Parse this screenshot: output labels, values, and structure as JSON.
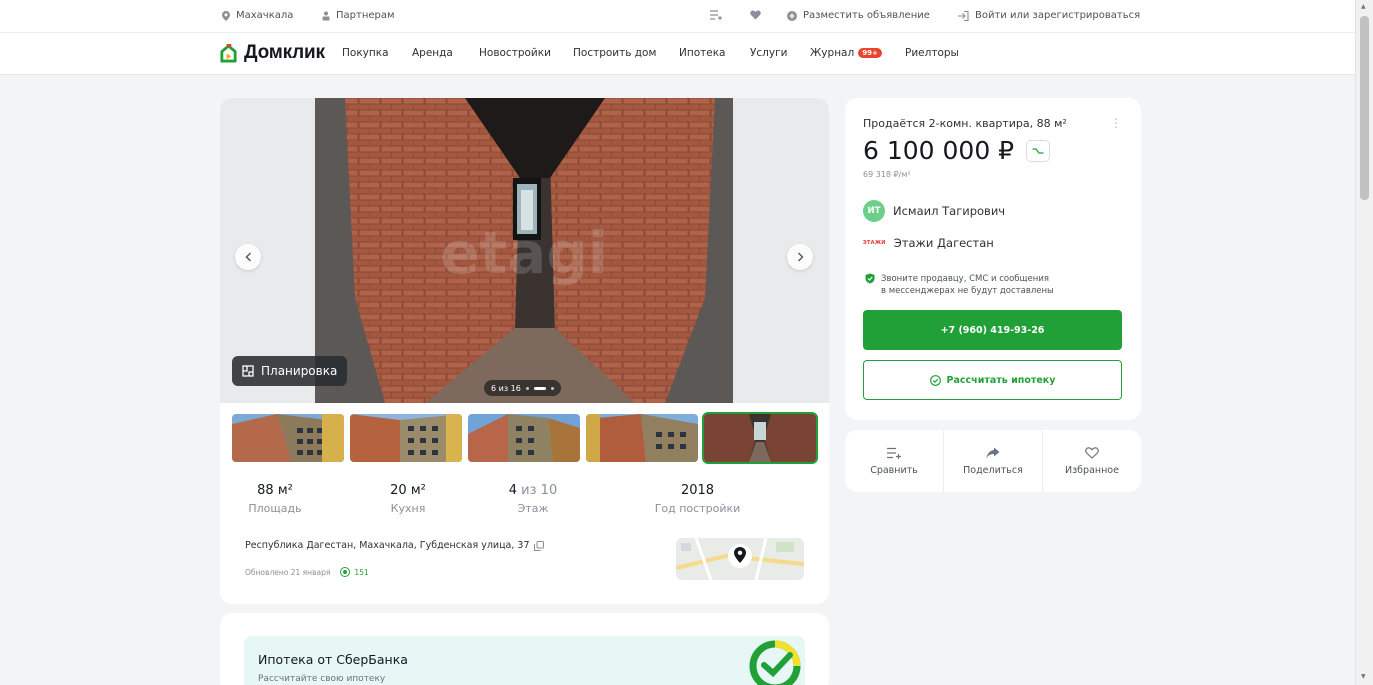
{
  "topbar": {
    "city": "Махачкала",
    "partners": "Партнерам",
    "post_ad": "Разместить объявление",
    "login": "Войти или зарегистрироваться"
  },
  "nav": {
    "logo": "Домклик",
    "items": [
      "Покупка",
      "Аренда",
      "Новостройки",
      "Построить дом",
      "Ипотека",
      "Услуги",
      "Журнал",
      "Риелторы"
    ],
    "journal_badge": "99+"
  },
  "gallery": {
    "watermark": "etagi",
    "plan_label": "Планировка",
    "counter": "6 из 16"
  },
  "params": [
    {
      "value": "88 м²",
      "label": "Площадь"
    },
    {
      "value": "20 м²",
      "label": "Кухня"
    },
    {
      "value_main": "4",
      "value_rest": " из 10",
      "label": "Этаж"
    },
    {
      "value": "2018",
      "label": "Год постройки"
    }
  ],
  "address": "Республика Дагестан, Махачкала, Губденская улица, 37",
  "updated": "Обновлено 21 января",
  "views": "151",
  "mortgage_banner": {
    "title": "Ипотека от СберБанка",
    "subtitle": "Рассчитайте свою ипотеку"
  },
  "offer": {
    "title": "Продаётся 2-комн. квартира, 88 м²",
    "price": "6 100 000 ₽",
    "price_per_sqm": "69 318 ₽/м²",
    "seller_initials": "ИТ",
    "seller_name": "Исмаил Тагирович",
    "agency_logo": "ЭТАЖИ",
    "agency": "Этажи Дагестан",
    "note_line1": "Звоните продавцу, СМС и сообщения",
    "note_line2": "в мессенджерах не будут доставлены",
    "phone": "+7 (960) 419-93-26",
    "calc_mortgage": "Рассчитать ипотеку"
  },
  "actions": {
    "compare": "Сравнить",
    "share": "Поделиться",
    "favorite": "Избранное"
  },
  "colors": {
    "brand_green": "#21a038",
    "badge_red": "#e8442e",
    "background": "#f3f4f6"
  }
}
